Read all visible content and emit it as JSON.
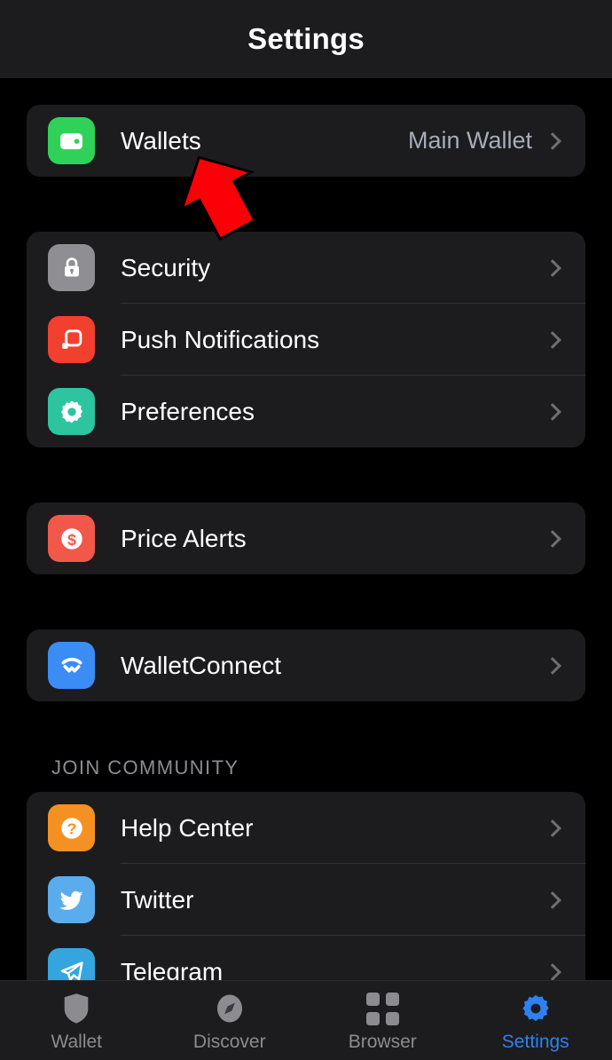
{
  "header": {
    "title": "Settings"
  },
  "sections": [
    {
      "name": "wallets-section",
      "header": null,
      "rows": [
        {
          "id": "wallets",
          "label": "Wallets",
          "value": "Main Wallet",
          "icon": "wallet-icon",
          "icon_color": "#30d158",
          "chevron": true
        }
      ]
    },
    {
      "name": "general-section",
      "header": null,
      "rows": [
        {
          "id": "security",
          "label": "Security",
          "value": null,
          "icon": "lock-icon",
          "icon_color": "#8e8e93",
          "chevron": true
        },
        {
          "id": "push-notifications",
          "label": "Push Notifications",
          "value": null,
          "icon": "push-notification-icon",
          "icon_color": "#f2402f",
          "chevron": true
        },
        {
          "id": "preferences",
          "label": "Preferences",
          "value": null,
          "icon": "gear-icon",
          "icon_color": "#2dc4a0",
          "chevron": true
        }
      ]
    },
    {
      "name": "price-alerts-section",
      "header": null,
      "rows": [
        {
          "id": "price-alerts",
          "label": "Price Alerts",
          "value": null,
          "icon": "dollar-coin-icon",
          "icon_color": "#f2584a",
          "chevron": true
        }
      ]
    },
    {
      "name": "walletconnect-section",
      "header": null,
      "rows": [
        {
          "id": "walletconnect",
          "label": "WalletConnect",
          "value": null,
          "icon": "walletconnect-icon",
          "icon_color": "#3b8cf5",
          "chevron": true
        }
      ]
    },
    {
      "name": "community-section",
      "header": "JOIN COMMUNITY",
      "rows": [
        {
          "id": "help-center",
          "label": "Help Center",
          "value": null,
          "icon": "question-mark-icon",
          "icon_color": "#f59022",
          "chevron": true
        },
        {
          "id": "twitter",
          "label": "Twitter",
          "value": null,
          "icon": "twitter-bird-icon",
          "icon_color": "#5aaced",
          "chevron": true
        },
        {
          "id": "telegram",
          "label": "Telegram",
          "value": null,
          "icon": "telegram-plane-icon",
          "icon_color": "#35a5e0",
          "chevron": true
        }
      ]
    }
  ],
  "annotation": {
    "type": "arrow",
    "color": "#fb0007",
    "points_to": "Wallets"
  },
  "tab_bar": {
    "tabs": [
      {
        "id": "wallet",
        "label": "Wallet",
        "icon": "shield-icon",
        "active": false
      },
      {
        "id": "discover",
        "label": "Discover",
        "icon": "compass-icon",
        "active": false
      },
      {
        "id": "browser",
        "label": "Browser",
        "icon": "grid-squares-icon",
        "active": false
      },
      {
        "id": "settings",
        "label": "Settings",
        "icon": "gear-icon",
        "active": true
      }
    ],
    "active_color": "#2f80f0",
    "inactive_color": "#8b8b90"
  }
}
